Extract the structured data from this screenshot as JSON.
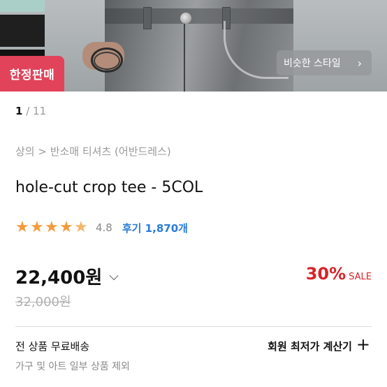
{
  "hero": {
    "limited_tag": "한정판매",
    "similar_style_label": "비슷한 스타일",
    "similar_style_icon": "chevron-right-icon",
    "chevron_glyph": "›"
  },
  "pager": {
    "current": "1",
    "separator": " / ",
    "total": "11"
  },
  "breadcrumb": "상의 > 반소매 티셔츠 (어반드레스)",
  "product": {
    "title": "hole-cut crop tee - 5COL",
    "rating": 4.8,
    "rating_text": "4.8",
    "stars": [
      "★",
      "★",
      "★",
      "★",
      "★"
    ],
    "reviews_label": "후기 1,870개",
    "price": "22,400원",
    "price_chevron": "⌵",
    "discount_percent": "30%",
    "sale_label": "SALE",
    "original_price": "32,000원"
  },
  "shipping": {
    "main": "전 상품 무료배송",
    "sub": "가구 및 아트 일부 상품 제외"
  },
  "member_price": {
    "label": "회원 최저가 계산기",
    "icon": "plus-icon",
    "glyph": "+"
  },
  "colors": {
    "accent_red": "#d8232a",
    "limited_tag_bg": "#e0435a",
    "star": "#f59a3b",
    "review_link": "#2a7bd6"
  }
}
